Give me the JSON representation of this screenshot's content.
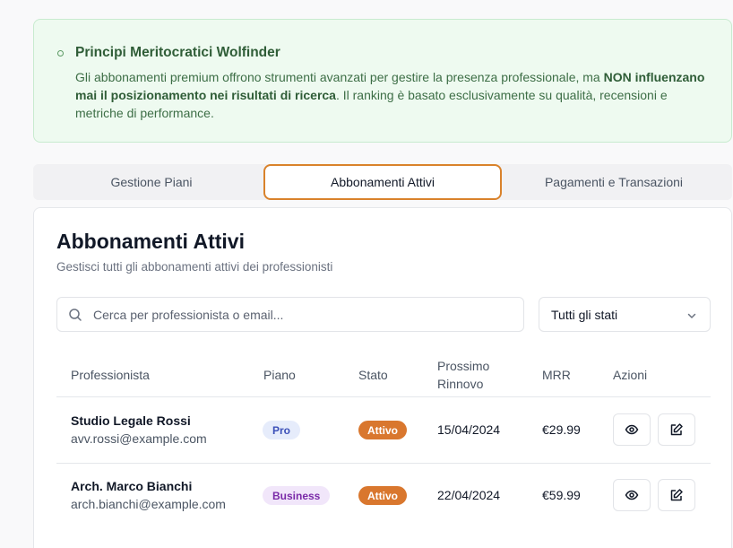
{
  "notice": {
    "title": "Principi Meritocratici Wolfinder",
    "text_before": "Gli abbonamenti premium offrono strumenti avanzati per gestire la presenza professionale, ma ",
    "text_bold": "NON influenzano mai il posizionamento nei risultati di ricerca",
    "text_after": ". Il ranking è basato esclusivamente su qualità, recensioni e metriche di performance."
  },
  "tabs": [
    {
      "label": "Gestione Piani"
    },
    {
      "label": "Abbonamenti Attivi",
      "active": true
    },
    {
      "label": "Pagamenti e Transazioni"
    }
  ],
  "card": {
    "title": "Abbonamenti Attivi",
    "subtitle": "Gestisci tutti gli abbonamenti attivi dei professionisti"
  },
  "search": {
    "placeholder": "Cerca per professionista o email...",
    "value": "",
    "icon": "search-icon"
  },
  "filter": {
    "value": "Tutti gli stati",
    "icon": "chevron-down-icon"
  },
  "table": {
    "headers": [
      "Professionista",
      "Piano",
      "Stato",
      "Prossimo Rinnovo",
      "MRR",
      "Azioni"
    ],
    "rows": [
      {
        "name": "Studio Legale Rossi",
        "email": "avv.rossi@example.com",
        "plan": "Pro",
        "status": "Attivo",
        "renewal": "15/04/2024",
        "mrr": "€29.99"
      },
      {
        "name": "Arch. Marco Bianchi",
        "email": "arch.bianchi@example.com",
        "plan": "Business",
        "status": "Attivo",
        "renewal": "22/04/2024",
        "mrr": "€59.99"
      }
    ],
    "actions": {
      "view_icon": "eye-icon",
      "edit_icon": "edit-icon"
    }
  },
  "colors": {
    "accent": "#d9822b",
    "status_active": "#d9772e",
    "plan_pro_bg": "#e6ecfb",
    "plan_pro_text": "#3b4fb8",
    "plan_business_bg": "#f1e6fa",
    "plan_business_text": "#7a2aa8",
    "notice_bg": "#eefaf0"
  }
}
